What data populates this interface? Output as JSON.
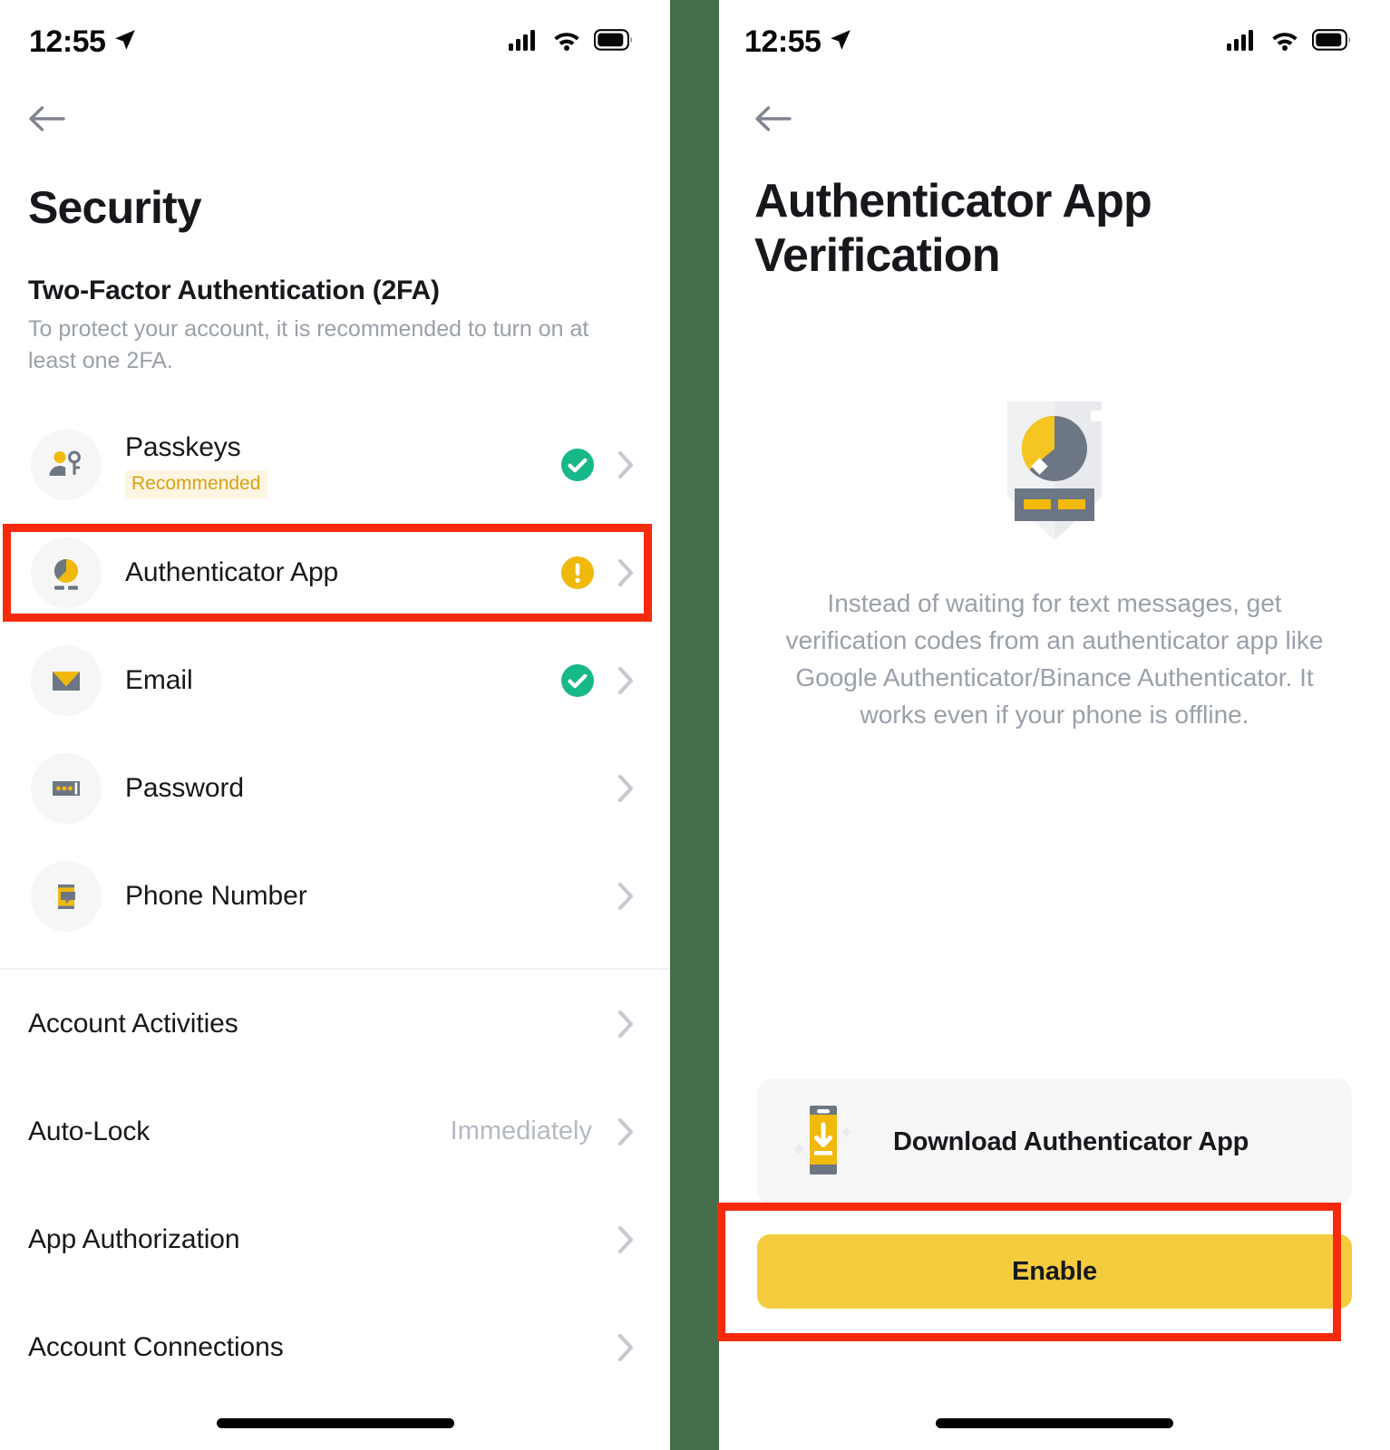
{
  "colors": {
    "brand_yellow": "#f4cc3e",
    "icon_yellow": "#f0b90b",
    "success_green": "#17b88a",
    "warning_yellow": "#f0b90b",
    "text_primary": "#17181c",
    "text_muted": "#9aa0a9",
    "annotation_red": "#f72b0c",
    "gap_green": "#476e4b"
  },
  "left_screen": {
    "status_bar": {
      "time": "12:55",
      "location_icon": "location-arrow-icon",
      "cellular_icon": "cellular-signal-icon",
      "wifi_icon": "wifi-icon",
      "battery_icon": "battery-full-icon"
    },
    "back_icon": "back-arrow-icon",
    "page_title": "Security",
    "section": {
      "heading": "Two-Factor Authentication (2FA)",
      "description": "To protect your account, it is recommended to turn on at least one 2FA."
    },
    "twofa_items": [
      {
        "label": "Passkeys",
        "badge": "Recommended",
        "icon": "passkey-person-key-icon",
        "status": "enabled",
        "status_icon": "check-circle-icon",
        "chevron": "chevron-right-icon"
      },
      {
        "label": "Authenticator App",
        "badge": "",
        "icon": "authenticator-pie-icon",
        "status": "warning",
        "status_icon": "warning-circle-icon",
        "chevron": "chevron-right-icon"
      },
      {
        "label": "Email",
        "badge": "",
        "icon": "email-envelope-icon",
        "status": "enabled",
        "status_icon": "check-circle-icon",
        "chevron": "chevron-right-icon"
      },
      {
        "label": "Password",
        "badge": "",
        "icon": "password-dots-icon",
        "status": "none",
        "status_icon": "",
        "chevron": "chevron-right-icon"
      },
      {
        "label": "Phone Number",
        "badge": "",
        "icon": "phone-sms-icon",
        "status": "none",
        "status_icon": "",
        "chevron": "chevron-right-icon"
      }
    ],
    "settings_items": [
      {
        "label": "Account Activities",
        "value": "",
        "chevron": "chevron-right-icon"
      },
      {
        "label": "Auto-Lock",
        "value": "Immediately",
        "chevron": "chevron-right-icon"
      },
      {
        "label": "App Authorization",
        "value": "",
        "chevron": "chevron-right-icon"
      },
      {
        "label": "Account Connections",
        "value": "",
        "chevron": "chevron-right-icon"
      }
    ]
  },
  "right_screen": {
    "status_bar": {
      "time": "12:55",
      "location_icon": "location-arrow-icon",
      "cellular_icon": "cellular-signal-icon",
      "wifi_icon": "wifi-icon",
      "battery_icon": "battery-full-icon"
    },
    "back_icon": "back-arrow-icon",
    "page_title": "Authenticator App Verification",
    "illustration_icon": "shield-pie-chart-illustration",
    "description": "Instead of waiting for text messages, get verification codes from an authenticator app like Google Authenticator/Binance Authenticator. It works even if your phone is offline.",
    "download_card": {
      "icon": "phone-download-icon",
      "label": "Download Authenticator App"
    },
    "primary_button": "Enable"
  },
  "annotations": [
    {
      "name": "highlight-authenticator-app-row",
      "color": "#f72b0c"
    },
    {
      "name": "highlight-enable-button",
      "color": "#f72b0c"
    }
  ]
}
